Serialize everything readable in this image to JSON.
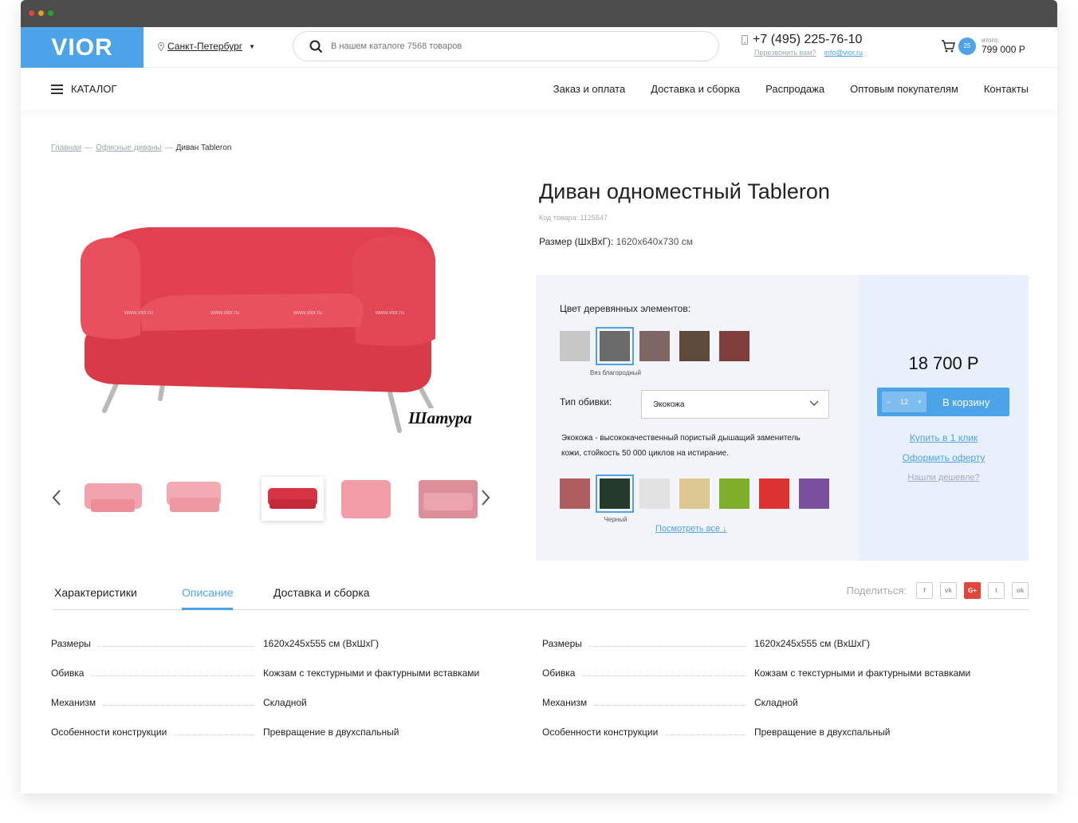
{
  "header": {
    "logo": "VIOR",
    "city": "Санкт-Петербург",
    "search_placeholder": "В нашем каталоге 7568 товаров",
    "phone": "+7 (495) 225-76-10",
    "callback": "Перезвонить вам?",
    "email": "info@vior.ru",
    "cart_count": "25",
    "cart_total_label": "итого:",
    "cart_total": "799 000 Р"
  },
  "nav": {
    "catalog": "КАТАЛОГ",
    "links": [
      "Заказ и оплата",
      "Доставка и сборка",
      "Распродажа",
      "Оптовым покупателям",
      "Контакты"
    ]
  },
  "breadcrumb": {
    "home": "Главная",
    "sep": "—",
    "category": "Офисные диваны",
    "current": "Диван Tableron"
  },
  "product": {
    "title": "Диван одноместный Tableron",
    "code": "Код товара: 1125547",
    "size_label": "Размер (ШхВхГ):",
    "size_value": "1620x640x730 см",
    "brand": "Шатура",
    "watermark": "www.vior.ru"
  },
  "options": {
    "wood_label": "Цвет деревянных элементов:",
    "wood_colors": [
      "#c7c7c7",
      "#6b6b6b",
      "#7d6664",
      "#5e4a3a",
      "#7f3e3c"
    ],
    "wood_selected_caption": "Вяз благородный",
    "upholstery_label": "Тип обивки:",
    "upholstery_value": "Экокожа",
    "upholstery_desc": "Экокожа - высококачественный пористый дышащий заменитель кожи, стойкость 50 000 циклов на истирание.",
    "fabric_colors": [
      "#ae5e5c",
      "#243a2c",
      "#e2e2e2",
      "#dcc890",
      "#7faf2a",
      "#dd3232",
      "#7a4f9d"
    ],
    "fabric_selected_caption": "Черный",
    "view_all": "Посмотреть все ↓"
  },
  "buy": {
    "price": "18 700 Р",
    "qty": "12",
    "qty_minus": "−",
    "qty_plus": "+",
    "cart_button": "В корзину",
    "one_click": "Купить в 1 клик",
    "offer": "Оформить оферту",
    "cheaper": "Нашли дешевле?"
  },
  "tabs": {
    "items": [
      "Характеристики",
      "Описание",
      "Доставка и сборка"
    ],
    "share_label": "Поделиться:",
    "share_buttons": [
      "f",
      "vk",
      "G+",
      "t",
      "ok"
    ]
  },
  "specs": {
    "rows": [
      {
        "k": "Размеры",
        "v": "1620x245x555 см (ВхШхГ)"
      },
      {
        "k": "Обивка",
        "v": "Кожзам с текстурными и фактурными вставками"
      },
      {
        "k": "Механизм",
        "v": "Складной"
      },
      {
        "k": "Особенности конструкции",
        "v": "Превращение в двухспальный"
      }
    ]
  },
  "colors": {
    "accent": "#4da3e8",
    "sofa": "#e0404f"
  }
}
